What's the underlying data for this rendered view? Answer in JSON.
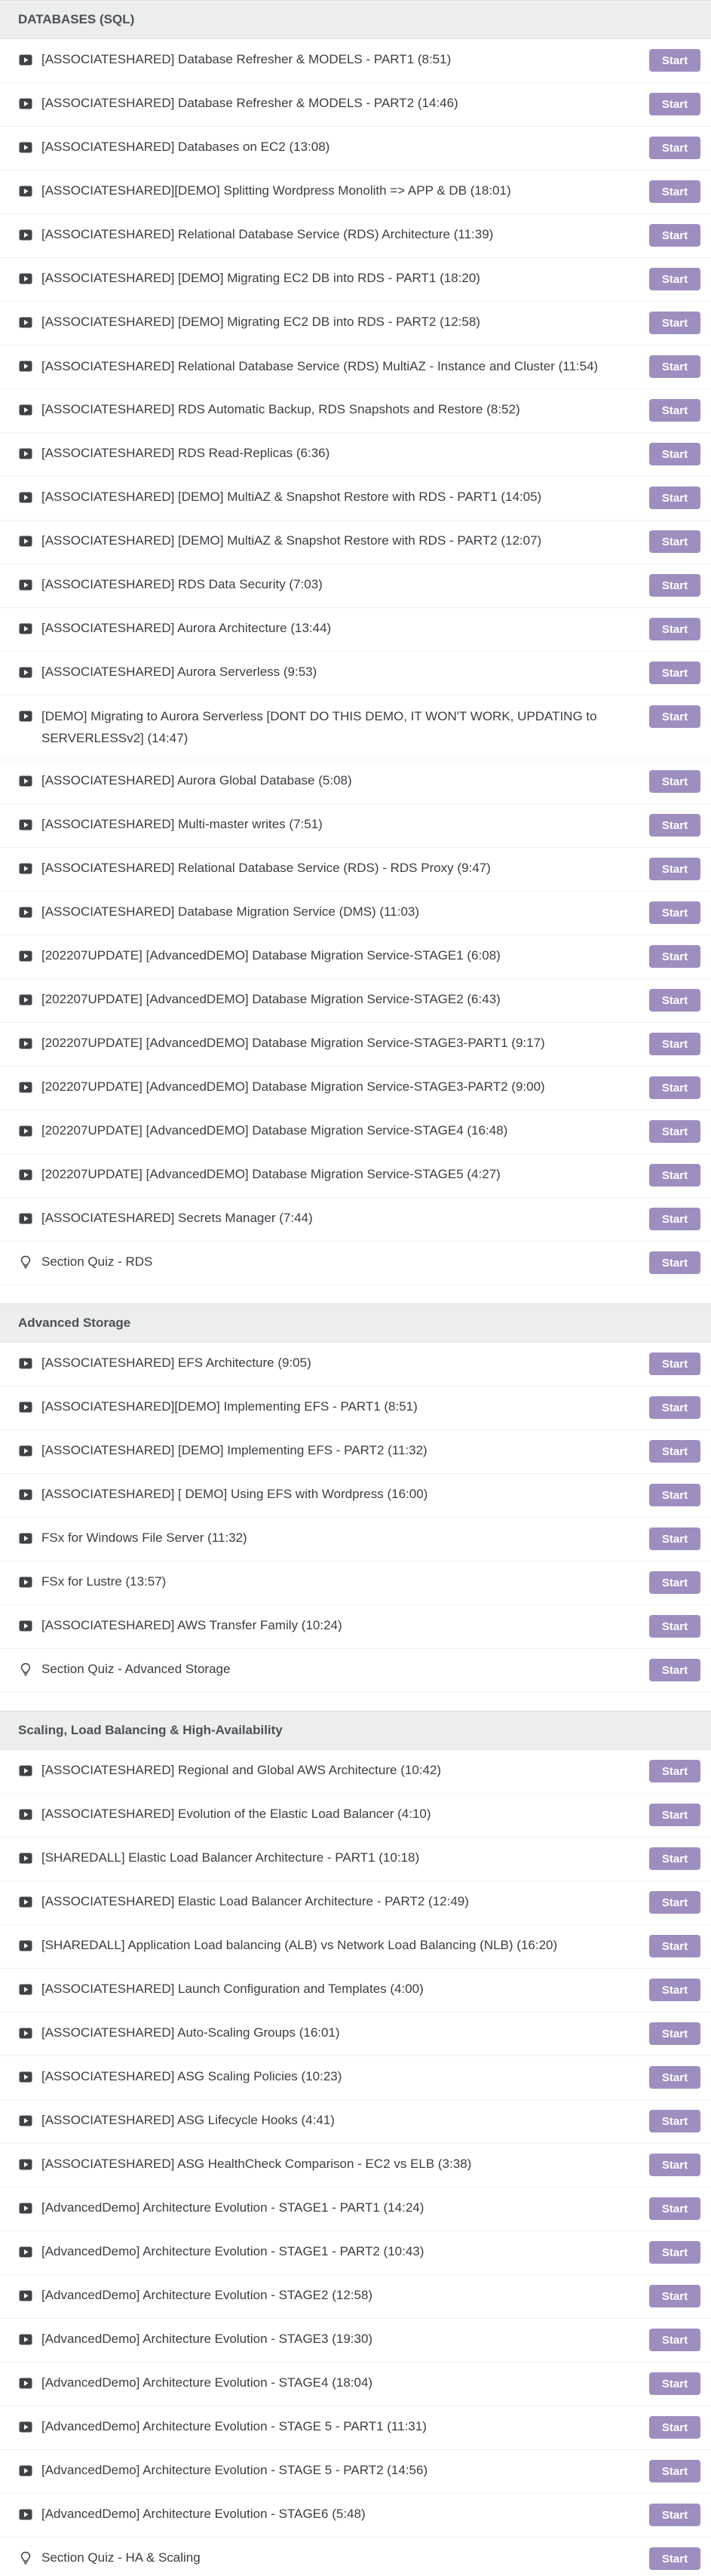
{
  "colors": {
    "accent": "#9e8ec0",
    "section_bg": "#eceded"
  },
  "start_label": "Start",
  "sections": [
    {
      "title": "DATABASES (SQL)",
      "items": [
        {
          "icon": "play-icon",
          "title": "[ASSOCIATESHARED] Database Refresher & MODELS - PART1 (8:51)"
        },
        {
          "icon": "play-icon",
          "title": "[ASSOCIATESHARED] Database Refresher & MODELS - PART2 (14:46)"
        },
        {
          "icon": "play-icon",
          "title": "[ASSOCIATESHARED] Databases on EC2 (13:08)"
        },
        {
          "icon": "play-icon",
          "title": "[ASSOCIATESHARED][DEMO] Splitting Wordpress Monolith => APP & DB (18:01)"
        },
        {
          "icon": "play-icon",
          "title": "[ASSOCIATESHARED] Relational Database Service (RDS) Architecture (11:39)"
        },
        {
          "icon": "play-icon",
          "title": "[ASSOCIATESHARED] [DEMO] Migrating EC2 DB into RDS - PART1 (18:20)"
        },
        {
          "icon": "play-icon",
          "title": "[ASSOCIATESHARED] [DEMO] Migrating EC2 DB into RDS - PART2 (12:58)"
        },
        {
          "icon": "play-icon",
          "title": "[ASSOCIATESHARED] Relational Database Service (RDS) MultiAZ - Instance and Cluster (11:54)",
          "two_line": true
        },
        {
          "icon": "play-icon",
          "title": "[ASSOCIATESHARED] RDS Automatic Backup, RDS Snapshots and Restore (8:52)"
        },
        {
          "icon": "play-icon",
          "title": "[ASSOCIATESHARED] RDS Read-Replicas (6:36)"
        },
        {
          "icon": "play-icon",
          "title": "[ASSOCIATESHARED] [DEMO] MultiAZ & Snapshot Restore with RDS - PART1 (14:05)"
        },
        {
          "icon": "play-icon",
          "title": "[ASSOCIATESHARED] [DEMO] MultiAZ & Snapshot Restore with RDS - PART2 (12:07)"
        },
        {
          "icon": "play-icon",
          "title": "[ASSOCIATESHARED] RDS Data Security (7:03)"
        },
        {
          "icon": "play-icon",
          "title": "[ASSOCIATESHARED] Aurora Architecture (13:44)"
        },
        {
          "icon": "play-icon",
          "title": "[ASSOCIATESHARED] Aurora Serverless (9:53)"
        },
        {
          "icon": "play-icon",
          "title": "[DEMO] Migrating to Aurora Serverless [DONT DO THIS DEMO, IT WON'T WORK, UPDATING to SERVERLESSv2] (14:47)",
          "two_line": true
        },
        {
          "icon": "play-icon",
          "title": "[ASSOCIATESHARED] Aurora Global Database (5:08)"
        },
        {
          "icon": "play-icon",
          "title": "[ASSOCIATESHARED] Multi-master writes (7:51)"
        },
        {
          "icon": "play-icon",
          "title": "[ASSOCIATESHARED] Relational Database Service (RDS) - RDS Proxy (9:47)"
        },
        {
          "icon": "play-icon",
          "title": "[ASSOCIATESHARED] Database Migration Service (DMS) (11:03)"
        },
        {
          "icon": "play-icon",
          "title": "[202207UPDATE] [AdvancedDEMO] Database Migration Service-STAGE1 (6:08)"
        },
        {
          "icon": "play-icon",
          "title": "[202207UPDATE] [AdvancedDEMO] Database Migration Service-STAGE2 (6:43)"
        },
        {
          "icon": "play-icon",
          "title": "[202207UPDATE] [AdvancedDEMO] Database Migration Service-STAGE3-PART1 (9:17)"
        },
        {
          "icon": "play-icon",
          "title": "[202207UPDATE] [AdvancedDEMO] Database Migration Service-STAGE3-PART2 (9:00)"
        },
        {
          "icon": "play-icon",
          "title": "[202207UPDATE] [AdvancedDEMO] Database Migration Service-STAGE4 (16:48)"
        },
        {
          "icon": "play-icon",
          "title": "[202207UPDATE] [AdvancedDEMO] Database Migration Service-STAGE5 (4:27)"
        },
        {
          "icon": "play-icon",
          "title": "[ASSOCIATESHARED] Secrets Manager (7:44)"
        },
        {
          "icon": "quiz-icon",
          "title": "Section Quiz - RDS"
        }
      ]
    },
    {
      "title": "Advanced Storage",
      "items": [
        {
          "icon": "play-icon",
          "title": "[ASSOCIATESHARED] EFS Architecture (9:05)"
        },
        {
          "icon": "play-icon",
          "title": "[ASSOCIATESHARED][DEMO] Implementing EFS - PART1 (8:51)"
        },
        {
          "icon": "play-icon",
          "title": "[ASSOCIATESHARED] [DEMO] Implementing EFS - PART2 (11:32)"
        },
        {
          "icon": "play-icon",
          "title": "[ASSOCIATESHARED] [ DEMO] Using EFS with Wordpress (16:00)"
        },
        {
          "icon": "play-icon",
          "title": "FSx for Windows File Server (11:32)"
        },
        {
          "icon": "play-icon",
          "title": "FSx for Lustre (13:57)"
        },
        {
          "icon": "play-icon",
          "title": "[ASSOCIATESHARED] AWS Transfer Family (10:24)"
        },
        {
          "icon": "quiz-icon",
          "title": "Section Quiz - Advanced Storage"
        }
      ]
    },
    {
      "title": "Scaling, Load Balancing & High-Availability",
      "items": [
        {
          "icon": "play-icon",
          "title": "[ASSOCIATESHARED] Regional and Global AWS Architecture (10:42)"
        },
        {
          "icon": "play-icon",
          "title": "[ASSOCIATESHARED] Evolution of the Elastic Load Balancer (4:10)"
        },
        {
          "icon": "play-icon",
          "title": "[SHAREDALL] Elastic Load Balancer Architecture - PART1 (10:18)"
        },
        {
          "icon": "play-icon",
          "title": "[ASSOCIATESHARED] Elastic Load Balancer Architecture - PART2 (12:49)"
        },
        {
          "icon": "play-icon",
          "title": "[SHAREDALL] Application Load balancing (ALB) vs Network Load Balancing (NLB) (16:20)"
        },
        {
          "icon": "play-icon",
          "title": "[ASSOCIATESHARED] Launch Configuration and Templates (4:00)"
        },
        {
          "icon": "play-icon",
          "title": "[ASSOCIATESHARED] Auto-Scaling Groups (16:01)"
        },
        {
          "icon": "play-icon",
          "title": "[ASSOCIATESHARED] ASG Scaling Policies (10:23)"
        },
        {
          "icon": "play-icon",
          "title": "[ASSOCIATESHARED] ASG Lifecycle Hooks (4:41)"
        },
        {
          "icon": "play-icon",
          "title": "[ASSOCIATESHARED] ASG HealthCheck Comparison - EC2 vs ELB (3:38)"
        },
        {
          "icon": "play-icon",
          "title": "[AdvancedDemo] Architecture Evolution - STAGE1 - PART1 (14:24)"
        },
        {
          "icon": "play-icon",
          "title": "[AdvancedDemo] Architecture Evolution - STAGE1 - PART2 (10:43)"
        },
        {
          "icon": "play-icon",
          "title": "[AdvancedDemo] Architecture Evolution - STAGE2 (12:58)"
        },
        {
          "icon": "play-icon",
          "title": "[AdvancedDemo] Architecture Evolution - STAGE3 (19:30)"
        },
        {
          "icon": "play-icon",
          "title": "[AdvancedDemo] Architecture Evolution - STAGE4 (18:04)"
        },
        {
          "icon": "play-icon",
          "title": "[AdvancedDemo] Architecture Evolution - STAGE 5 - PART1 (11:31)"
        },
        {
          "icon": "play-icon",
          "title": "[AdvancedDemo] Architecture Evolution - STAGE 5 - PART2 (14:56)"
        },
        {
          "icon": "play-icon",
          "title": "[AdvancedDemo] Architecture Evolution - STAGE6 (5:48)"
        },
        {
          "icon": "quiz-icon",
          "title": "Section Quiz - HA & Scaling"
        }
      ]
    }
  ]
}
